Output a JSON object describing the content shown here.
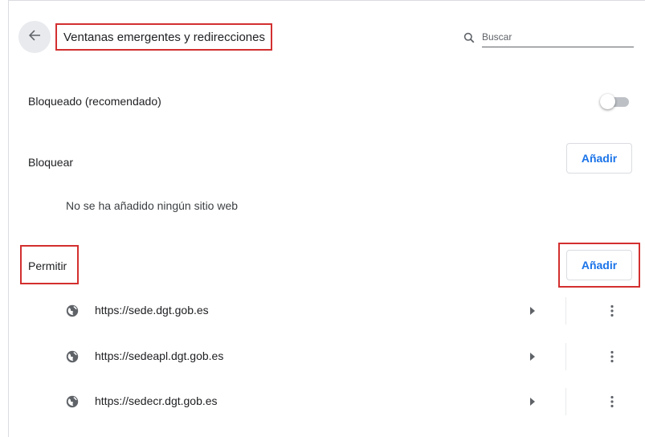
{
  "header": {
    "title": "Ventanas emergentes y redirecciones",
    "back_icon": "arrow-back-icon",
    "search": {
      "placeholder": "Buscar",
      "value": "",
      "icon": "search-icon"
    }
  },
  "blocked_setting": {
    "label": "Bloqueado (recomendado)",
    "toggle_on": false
  },
  "block_section": {
    "heading": "Bloquear",
    "add_label": "Añadir",
    "empty_message": "No se ha añadido ningún sitio web"
  },
  "allow_section": {
    "heading": "Permitir",
    "add_label": "Añadir",
    "sites": [
      {
        "url": "https://sede.dgt.gob.es",
        "icon": "globe-icon"
      },
      {
        "url": "https://sedeapl.dgt.gob.es",
        "icon": "globe-icon"
      },
      {
        "url": "https://sedecr.dgt.gob.es",
        "icon": "globe-icon"
      }
    ]
  },
  "colors": {
    "accent": "#1a73e8",
    "highlight": "#d32f2f",
    "toggle_track": "#bdc1c6"
  }
}
